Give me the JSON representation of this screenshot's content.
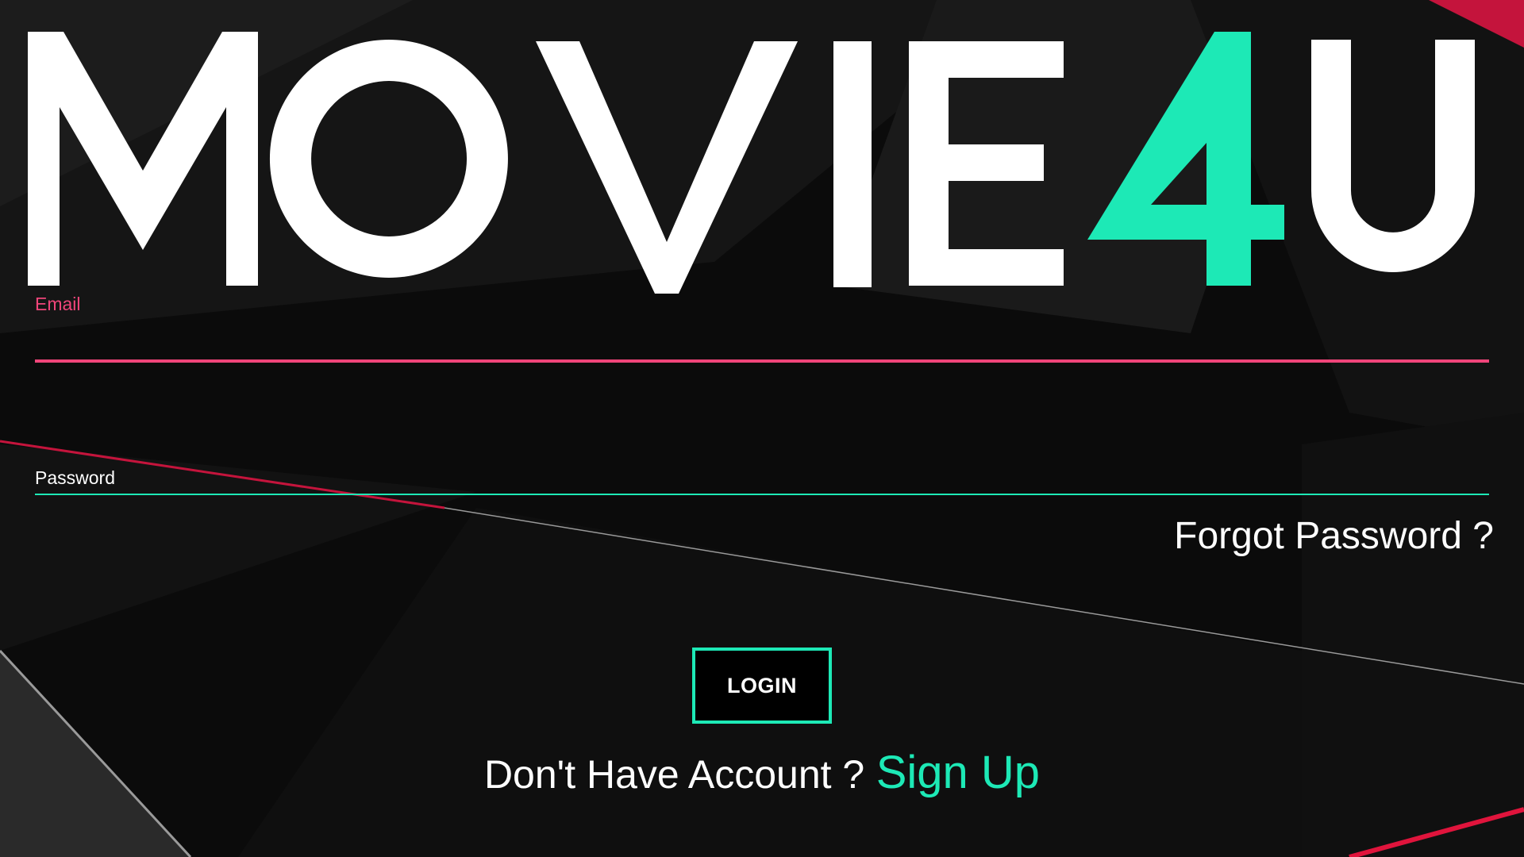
{
  "app": {
    "logo_text_main": "MOVIE",
    "logo_text_accent": "4",
    "logo_text_end": "U"
  },
  "colors": {
    "accent_teal": "#1de9b6",
    "accent_pink": "#f0457a",
    "background": "#0b0b0b",
    "text": "#ffffff"
  },
  "login_form": {
    "email": {
      "label": "Email",
      "value": "",
      "placeholder": ""
    },
    "password": {
      "label": "Password",
      "value": "",
      "placeholder": ""
    },
    "forgot_password_label": "Forgot Password ?",
    "login_button_label": "LOGIN",
    "signup_prompt": "Don't Have Account ?",
    "signup_link_label": "Sign Up"
  }
}
